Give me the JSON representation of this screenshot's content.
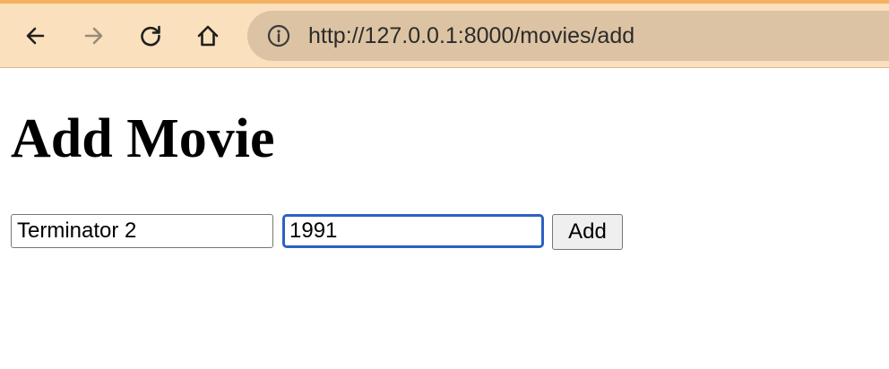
{
  "browser": {
    "url": "http://127.0.0.1:8000/movies/add",
    "back_icon": "arrow-left",
    "forward_icon": "arrow-right",
    "reload_icon": "reload",
    "home_icon": "home",
    "site_info_icon": "info-circle",
    "colors": {
      "toolbar_bg": "#fae0bd",
      "accent_top": "#f3b15f",
      "urlbar_bg": "#dcc3a3"
    }
  },
  "page": {
    "heading": "Add Movie",
    "form": {
      "title_value": "Terminator 2",
      "year_value": "1991",
      "submit_label": "Add"
    },
    "colors": {
      "focus_ring": "#2c61c3"
    }
  }
}
